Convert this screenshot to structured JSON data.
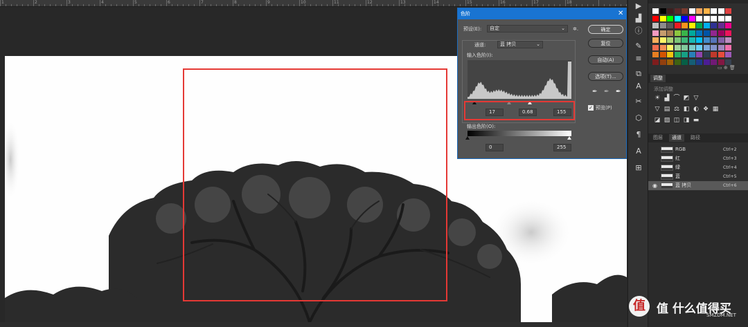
{
  "ruler": {
    "labels": [
      "1",
      "2",
      "3",
      "4",
      "5",
      "6",
      "7",
      "8",
      "9",
      "10",
      "11",
      "12",
      "13",
      "14",
      "15",
      "16",
      "17",
      "18"
    ]
  },
  "dialog": {
    "title": "色阶",
    "preset_label": "预设(E):",
    "preset_value": "自定",
    "channel_label": "通道:",
    "channel_value": "蓝 拷贝",
    "input_levels_label": "输入色阶(I):",
    "input_black": "17",
    "input_gamma": "0.68",
    "input_white": "155",
    "output_levels_label": "输出色阶(O):",
    "output_black": "0",
    "output_white": "255",
    "buttons": {
      "ok": "确定",
      "reset": "复位",
      "auto": "自动(A)",
      "options": "选项(T)..."
    },
    "preview_label": "预览(P)",
    "preview_checked": true
  },
  "adjustments": {
    "tab": "调整",
    "hint": "添加调整"
  },
  "channels": {
    "tabs": [
      "图层",
      "通道",
      "路径"
    ],
    "active_tab": "通道",
    "rows": [
      {
        "name": "RGB",
        "shortcut": "Ctrl+2"
      },
      {
        "name": "红",
        "shortcut": "Ctrl+3"
      },
      {
        "name": "绿",
        "shortcut": "Ctrl+4"
      },
      {
        "name": "蓝",
        "shortcut": "Ctrl+5"
      },
      {
        "name": "蓝 拷贝",
        "shortcut": "Ctrl+6"
      }
    ]
  },
  "watermark": {
    "text": "值 什么值得买",
    "sub": "SMZDM.NET"
  },
  "colors": {
    "accent": "#1974d2",
    "highlight": "#e53935"
  }
}
